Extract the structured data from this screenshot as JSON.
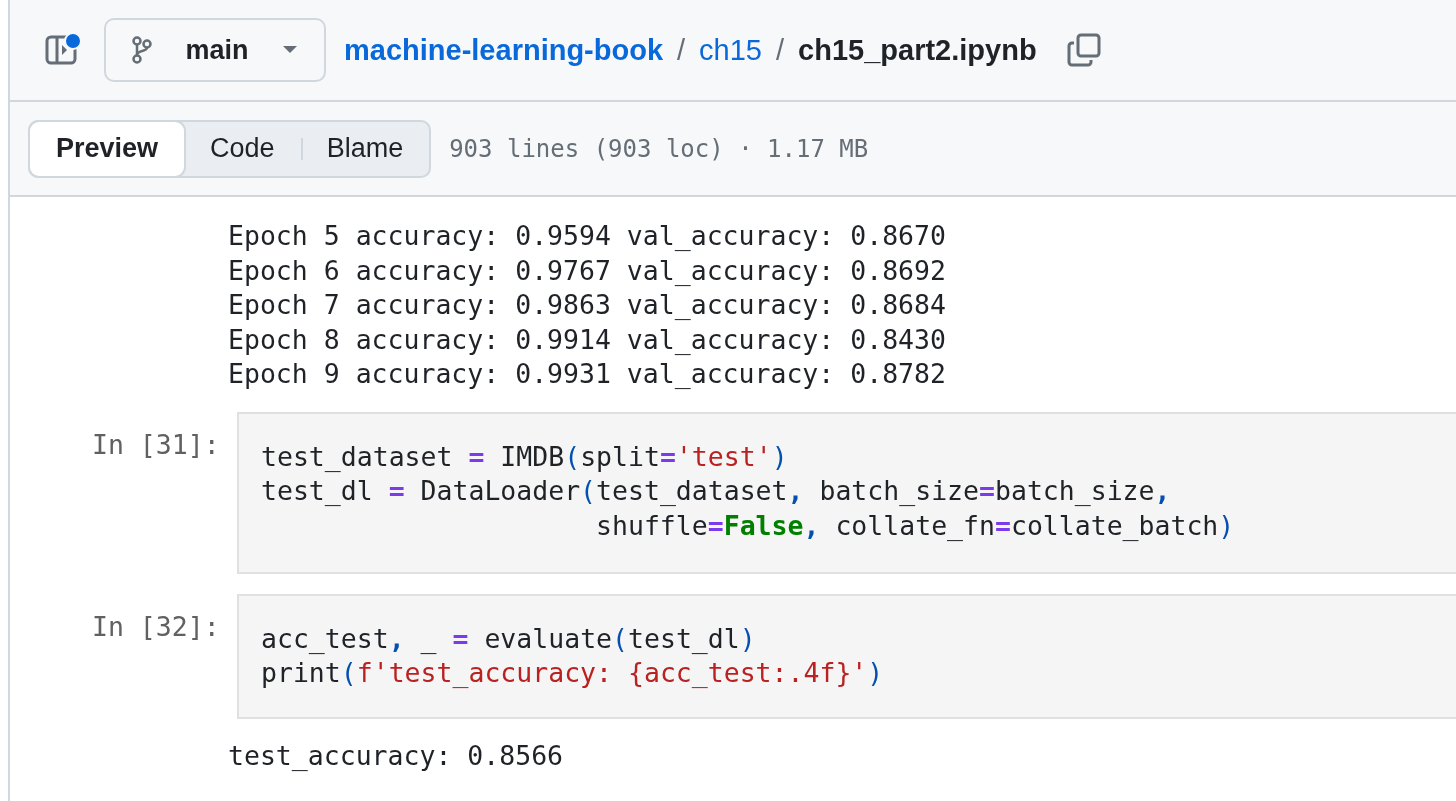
{
  "header": {
    "sidebar_notification": true,
    "branch": "main",
    "separator": "/",
    "breadcrumb": [
      {
        "text": "machine-learning-book",
        "kind": "repo"
      },
      {
        "text": "ch15",
        "kind": "dir"
      },
      {
        "text": "ch15_part2.ipynb",
        "kind": "file"
      }
    ]
  },
  "view_tabs": [
    {
      "label": "Preview",
      "selected": true
    },
    {
      "label": "Code",
      "selected": false
    },
    {
      "label": "Blame",
      "selected": false
    }
  ],
  "file_info": "903 lines (903 loc) · 1.17 MB",
  "notebook": [
    {
      "kind": "output",
      "lines": [
        "Epoch 5 accuracy: 0.9594 val_accuracy: 0.8670",
        "Epoch 6 accuracy: 0.9767 val_accuracy: 0.8692",
        "Epoch 7 accuracy: 0.9863 val_accuracy: 0.8684",
        "Epoch 8 accuracy: 0.9914 val_accuracy: 0.8430",
        "Epoch 9 accuracy: 0.9931 val_accuracy: 0.8782"
      ]
    },
    {
      "kind": "code",
      "prompt": "In [31]:",
      "lines": [
        [
          {
            "kind": "name",
            "text": "test_dataset "
          },
          {
            "kind": "op",
            "text": "="
          },
          {
            "kind": "name",
            "text": " IMDB"
          },
          {
            "kind": "paren",
            "text": "("
          },
          {
            "kind": "name",
            "text": "split"
          },
          {
            "kind": "op",
            "text": "="
          },
          {
            "kind": "str",
            "text": "'test'"
          },
          {
            "kind": "paren",
            "text": ")"
          }
        ],
        [
          {
            "kind": "name",
            "text": "test_dl "
          },
          {
            "kind": "op",
            "text": "="
          },
          {
            "kind": "name",
            "text": " DataLoader"
          },
          {
            "kind": "paren",
            "text": "("
          },
          {
            "kind": "name",
            "text": "test_dataset"
          },
          {
            "kind": "punct",
            "text": ","
          },
          {
            "kind": "name",
            "text": " batch_size"
          },
          {
            "kind": "op",
            "text": "="
          },
          {
            "kind": "name",
            "text": "batch_size"
          },
          {
            "kind": "punct",
            "text": ","
          }
        ],
        [
          {
            "kind": "name",
            "text": "                     shuffle"
          },
          {
            "kind": "op",
            "text": "="
          },
          {
            "kind": "kw",
            "text": "False"
          },
          {
            "kind": "punct",
            "text": ","
          },
          {
            "kind": "name",
            "text": " collate_fn"
          },
          {
            "kind": "op",
            "text": "="
          },
          {
            "kind": "name",
            "text": "collate_batch"
          },
          {
            "kind": "paren",
            "text": ")"
          }
        ]
      ]
    },
    {
      "kind": "code",
      "prompt": "In [32]:",
      "lines": [
        [
          {
            "kind": "name",
            "text": "acc_test"
          },
          {
            "kind": "punct",
            "text": ","
          },
          {
            "kind": "name",
            "text": " _ "
          },
          {
            "kind": "op",
            "text": "="
          },
          {
            "kind": "name",
            "text": " evaluate"
          },
          {
            "kind": "paren",
            "text": "("
          },
          {
            "kind": "name",
            "text": "test_dl"
          },
          {
            "kind": "paren",
            "text": ")"
          }
        ],
        [
          {
            "kind": "name",
            "text": "print"
          },
          {
            "kind": "paren",
            "text": "("
          },
          {
            "kind": "str",
            "text": "f'test_accuracy: {acc_test:.4f}'"
          },
          {
            "kind": "paren",
            "text": ")"
          }
        ]
      ]
    },
    {
      "kind": "output",
      "lines": [
        "test_accuracy: 0.8566"
      ]
    }
  ]
}
